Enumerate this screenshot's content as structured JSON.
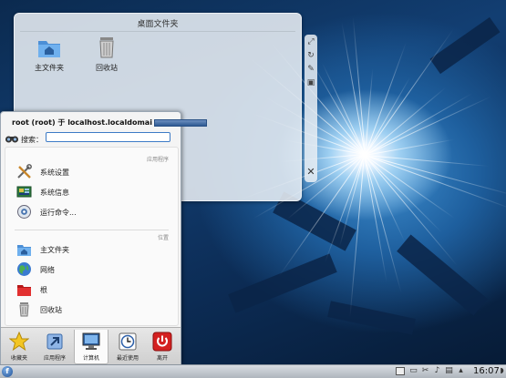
{
  "folder_view": {
    "title": "桌面文件夹",
    "items": [
      {
        "label": "主文件夹",
        "icon": "home-folder-icon"
      },
      {
        "label": "回收站",
        "icon": "trash-icon"
      }
    ],
    "toolbar_icons": [
      "resize-icon",
      "rotate-icon",
      "settings-icon",
      "config-icon"
    ],
    "close_icon": "close-icon"
  },
  "launcher": {
    "user_line": "root (root) 于 localhost.localdomai",
    "search_label": "搜索：",
    "search_value": "",
    "sections": {
      "apps": "应用程序",
      "places": "位置"
    },
    "app_items": [
      {
        "label": "系统设置",
        "icon": "system-settings-icon"
      },
      {
        "label": "系统信息",
        "icon": "system-info-icon"
      },
      {
        "label": "运行命令...",
        "icon": "run-command-icon"
      }
    ],
    "place_items": [
      {
        "label": "主文件夹",
        "icon": "home-folder-icon"
      },
      {
        "label": "网络",
        "icon": "network-icon"
      },
      {
        "label": "根",
        "icon": "root-folder-icon"
      },
      {
        "label": "回收站",
        "icon": "trash-icon"
      }
    ],
    "tabs": [
      {
        "label": "收藏夹",
        "icon": "star-icon",
        "active": false
      },
      {
        "label": "应用程序",
        "icon": "applications-icon",
        "active": false
      },
      {
        "label": "计算机",
        "icon": "computer-icon",
        "active": true
      },
      {
        "label": "最近使用",
        "icon": "clock-icon",
        "active": false
      },
      {
        "label": "离开",
        "icon": "power-icon",
        "active": false
      }
    ]
  },
  "panel": {
    "clock": "16:07",
    "tray_icons": [
      "device-notifier-icon",
      "network-manager-icon",
      "volume-icon",
      "clipboard-icon"
    ]
  },
  "colors": {
    "accent": "#3d7bc6",
    "desktop_dark": "#0c2c55",
    "desktop_glow": "#9fd0f2",
    "power_red": "#d42020"
  }
}
